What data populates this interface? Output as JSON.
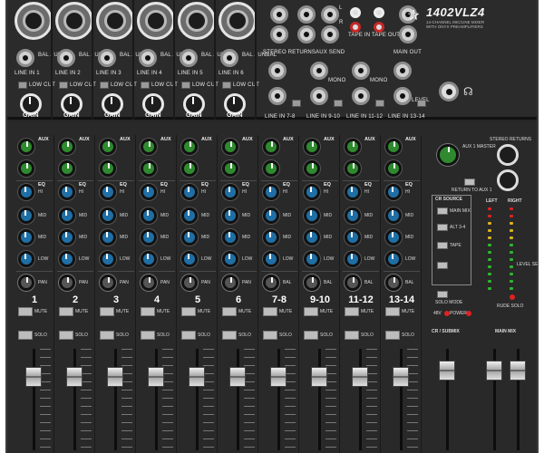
{
  "model": {
    "name": "1402VLZ4",
    "subtitle_line1": "14-CHANNEL MIC/LINE MIXER",
    "subtitle_line2": "WITH ONYX PREAMPLIFIERS"
  },
  "top_inputs": [
    {
      "label": "LINE IN 1",
      "knob": "GAIN"
    },
    {
      "label": "LINE IN 2",
      "knob": "GAIN"
    },
    {
      "label": "LINE IN 3",
      "knob": "GAIN"
    },
    {
      "label": "LINE IN 4",
      "knob": "GAIN"
    },
    {
      "label": "LINE IN 5",
      "knob": "GAIN"
    },
    {
      "label": "LINE IN 6",
      "knob": "GAIN"
    }
  ],
  "top_labels": {
    "low_cut": "LOW CUT",
    "stereo_returns": "STEREO RETURNS",
    "aux_send": "AUX SEND",
    "tape_in": "TAPE IN",
    "tape_out": "TAPE OUT",
    "main_out": "MAIN OUT",
    "line_in_7_8": "LINE IN 7-8",
    "line_in_9_10": "LINE IN 9-10",
    "line_in_11_12": "LINE IN 11-12",
    "line_in_13_14": "LINE IN 13-14",
    "bal_unbal": "BAL / UNBAL",
    "mono": "MONO",
    "left": "L",
    "right": "R",
    "level": "LEVEL"
  },
  "strip_labels": {
    "aux": "AUX",
    "eq": "EQ",
    "hi": "HI",
    "mid": "MID",
    "low": "LOW",
    "pan": "PAN",
    "bal": "BAL",
    "mute": "MUTE",
    "solo": "SOLO"
  },
  "channels": [
    {
      "num": "1",
      "pan": "PAN",
      "fader": 0.18
    },
    {
      "num": "2",
      "pan": "PAN",
      "fader": 0.18
    },
    {
      "num": "3",
      "pan": "PAN",
      "fader": 0.18
    },
    {
      "num": "4",
      "pan": "PAN",
      "fader": 0.18
    },
    {
      "num": "5",
      "pan": "PAN",
      "fader": 0.18
    },
    {
      "num": "6",
      "pan": "PAN",
      "fader": 0.18
    },
    {
      "num": "7-8",
      "pan": "BAL",
      "fader": 0.18
    },
    {
      "num": "9-10",
      "pan": "BAL",
      "fader": 0.18
    },
    {
      "num": "11-12",
      "pan": "BAL",
      "fader": 0.18
    },
    {
      "num": "13-14",
      "pan": "BAL",
      "fader": 0.18
    }
  ],
  "master": {
    "aux1_master": "AUX 1 MASTER",
    "stereo_returns": "STEREO RETURNS",
    "return_to_aux1": "RETURN TO AUX 1",
    "cr_source": "CR SOURCE",
    "main_mix": "MAIN MIX",
    "alt": "ALT 3-4",
    "tape": "TAPE",
    "solo_mode": "SOLO MODE",
    "power": "POWER",
    "phantom": "48V",
    "left": "LEFT",
    "right": "RIGHT",
    "level_set": "LEVEL SET",
    "rude_solo": "RUDE SOLO",
    "cr_submix": "CR / SUBMIX",
    "main_mix_fader": "MAIN MIX",
    "sub_fader": 0.12,
    "main_fader": 0.12
  },
  "colors": {
    "aux_knob": "#2f8a2f",
    "eq_knob": "#1f6fa5",
    "panel": "#292929"
  }
}
